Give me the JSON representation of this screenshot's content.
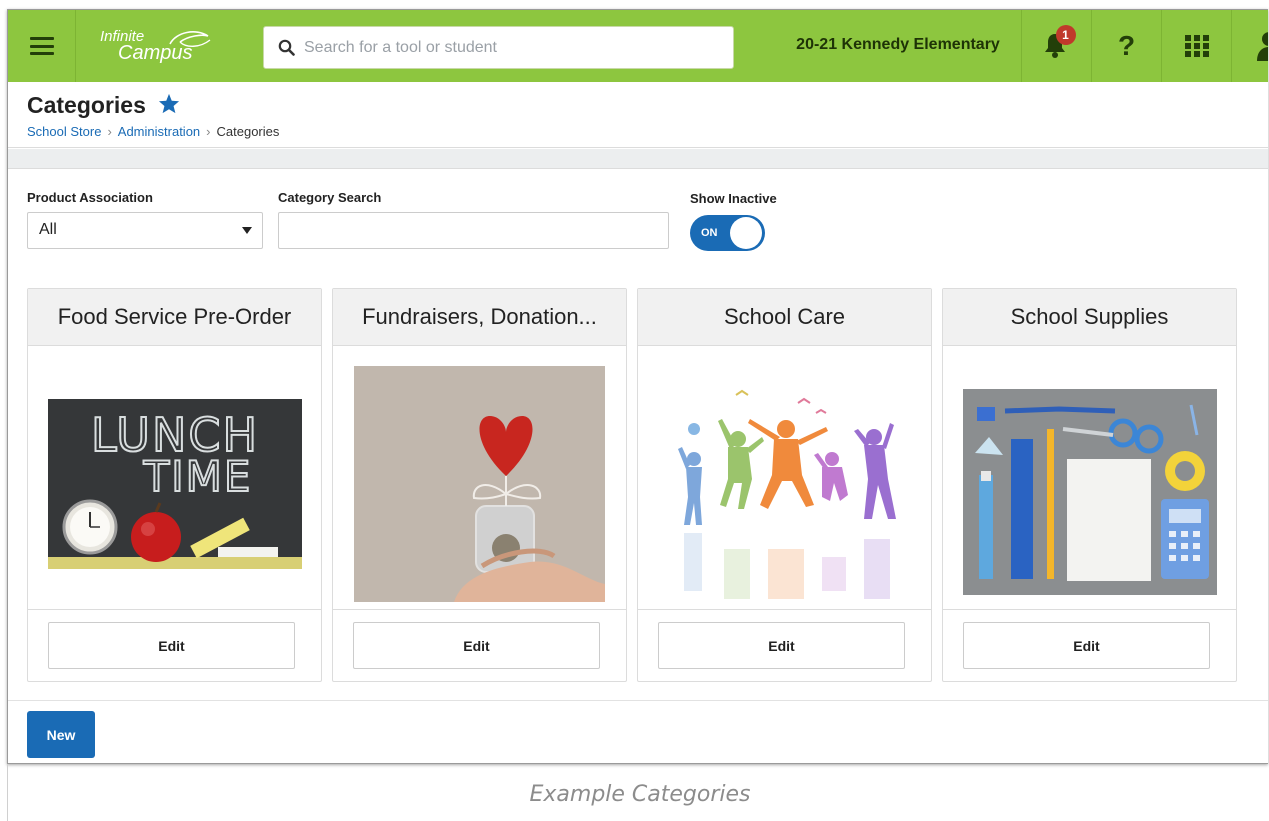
{
  "topbar": {
    "logo_line1": "Infinite",
    "logo_line2": "Campus",
    "search_placeholder": "Search for a tool or student",
    "school": "20-21 Kennedy Elementary",
    "notification_count": "1",
    "help_label": "?",
    "colors": {
      "bar": "#8dc63f",
      "icon": "#233f09"
    }
  },
  "header": {
    "title": "Categories",
    "breadcrumb": [
      "School Store",
      "Administration",
      "Categories"
    ]
  },
  "filters": {
    "product_association_label": "Product Association",
    "product_association_value": "All",
    "category_search_label": "Category Search",
    "category_search_value": "",
    "show_inactive_label": "Show Inactive",
    "show_inactive_state": "ON"
  },
  "cards": [
    {
      "title": "Food Service Pre-Order",
      "image": "lunch-time-chalkboard-image",
      "image_text": [
        "LUNCH",
        "TIME"
      ],
      "edit_label": "Edit"
    },
    {
      "title": "Fundraisers, Donation...",
      "image": "heart-donation-jar-image",
      "edit_label": "Edit"
    },
    {
      "title": "School Care",
      "image": "jumping-children-silhouettes-image",
      "edit_label": "Edit"
    },
    {
      "title": "School Supplies",
      "image": "school-supplies-flatlay-image",
      "edit_label": "Edit"
    }
  ],
  "actions": {
    "new_label": "New",
    "accent": "#1a6bb5"
  },
  "caption": "Example Categories"
}
